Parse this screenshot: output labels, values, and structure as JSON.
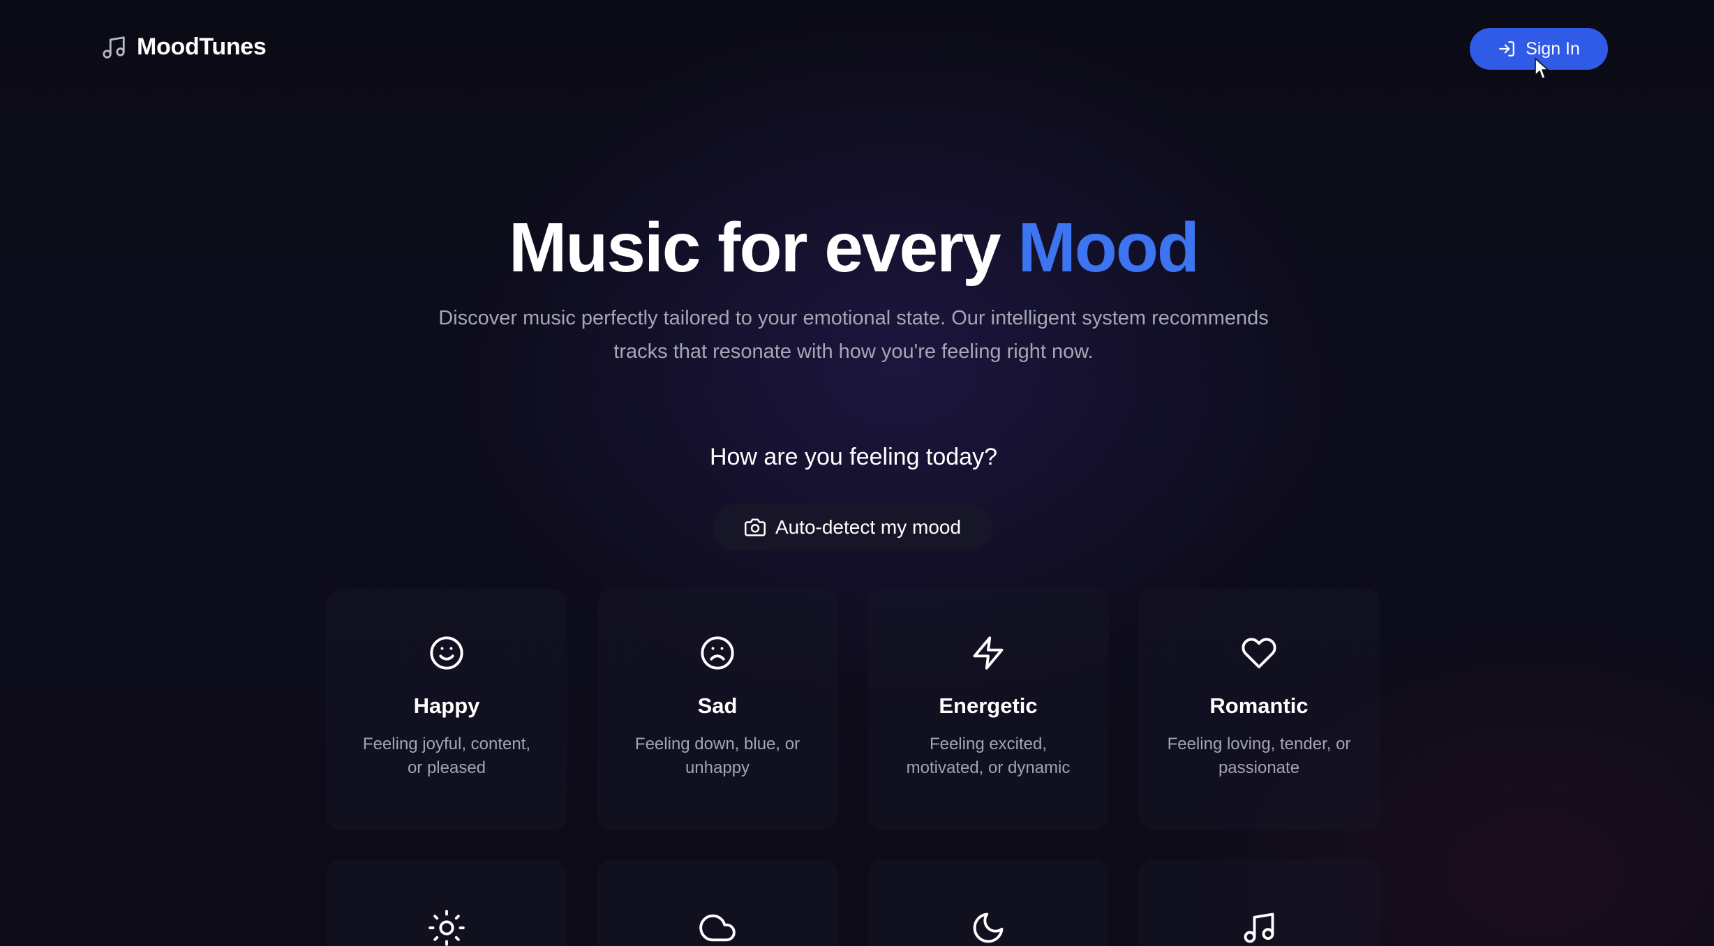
{
  "header": {
    "logo_text": "MoodTunes",
    "logo_icon": "music-note-icon",
    "signin_label": "Sign In",
    "signin_icon": "log-in-icon"
  },
  "hero": {
    "title_main": "Music for every ",
    "title_accent": "Mood",
    "subtitle": "Discover music perfectly tailored to your emotional state. Our intelligent system recommends tracks that resonate with how you're feeling right now."
  },
  "mood_picker": {
    "question": "How are you feeling today?",
    "autodetect_label": "Auto-detect my mood",
    "autodetect_icon": "camera-icon",
    "moods": [
      {
        "name": "Happy",
        "description": "Feeling joyful, content, or pleased",
        "icon": "smile-icon"
      },
      {
        "name": "Sad",
        "description": "Feeling down, blue, or unhappy",
        "icon": "frown-icon"
      },
      {
        "name": "Energetic",
        "description": "Feeling excited, motivated, or dynamic",
        "icon": "zap-icon"
      },
      {
        "name": "Romantic",
        "description": "Feeling loving, tender, or passionate",
        "icon": "heart-icon"
      },
      {
        "icon": "sun-icon"
      },
      {
        "icon": "cloud-icon"
      },
      {
        "icon": "moon-icon"
      },
      {
        "icon": "music-icon"
      }
    ]
  },
  "colors": {
    "accent": "#3d74f0",
    "signin_bg": "#2f5be6",
    "background": "#0b0b16",
    "muted_text": "#a6a6b5"
  }
}
